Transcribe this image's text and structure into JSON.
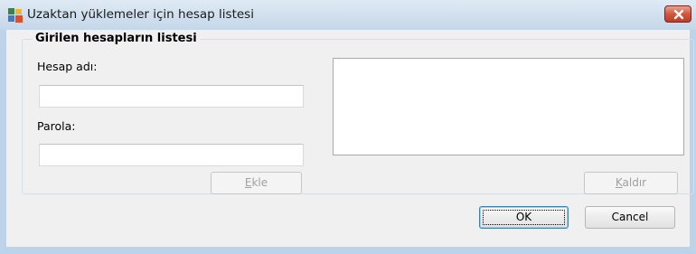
{
  "window": {
    "title": "Uzaktan yüklemeler için hesap listesi",
    "icon": "avg-logo-icon",
    "close_icon": "close-x-icon"
  },
  "group": {
    "title": "Girilen hesapların listesi",
    "account_name_label": "Hesap adı:",
    "account_name_value": "",
    "password_label": "Parola:",
    "password_value": "",
    "accounts_list_items": []
  },
  "buttons": {
    "add": {
      "before": "",
      "mnemonic": "E",
      "after": "kle",
      "enabled": false
    },
    "remove": {
      "before": "",
      "mnemonic": "K",
      "after": "aldır",
      "enabled": false
    },
    "ok": "OK",
    "cancel": "Cancel"
  },
  "colors": {
    "titlebar": "#cfdeed",
    "frame": "#bcd3ea",
    "client": "#f0f0f0",
    "close_button": "#c8452d"
  }
}
